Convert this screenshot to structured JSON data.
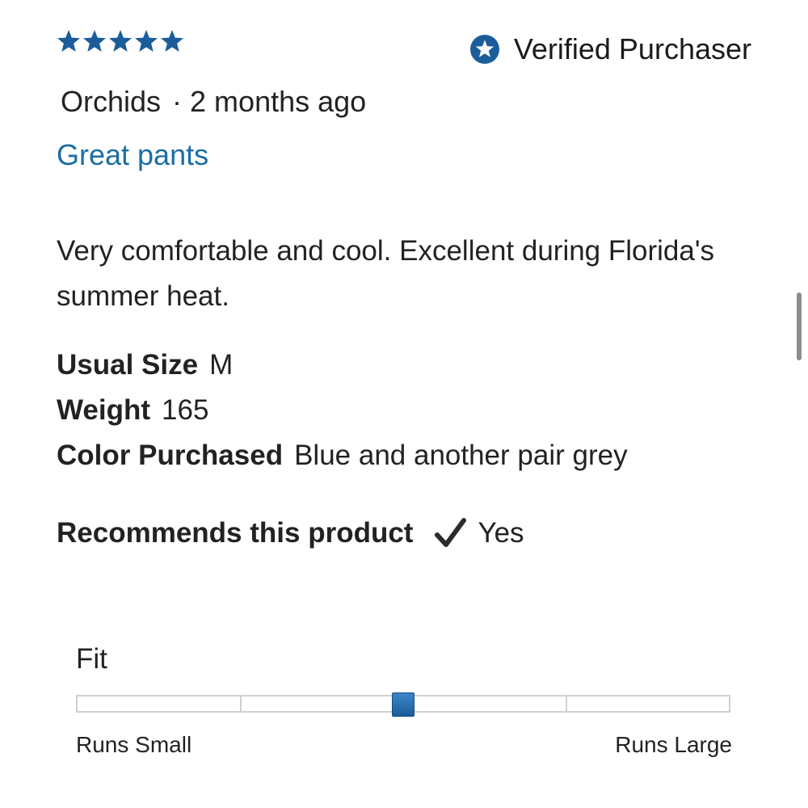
{
  "rating": {
    "stars": 5,
    "max": 5,
    "color": "#1b5d9a"
  },
  "verified": {
    "label": "Verified Purchaser",
    "icon": "star-badge-icon",
    "color": "#1b5d9a"
  },
  "author": {
    "name": "Orchids",
    "separator": "·",
    "time": "2 months ago"
  },
  "review": {
    "title": "Great pants",
    "title_color": "#1b6da2",
    "body": "Very comfortable and cool. Excellent during Florida's summer heat."
  },
  "attributes": [
    {
      "label": "Usual Size",
      "value": "M"
    },
    {
      "label": "Weight",
      "value": "165"
    },
    {
      "label": "Color Purchased",
      "value": "Blue and another pair grey"
    }
  ],
  "recommends": {
    "label": "Recommends this product",
    "icon": "checkmark-icon",
    "value": "Yes"
  },
  "fit": {
    "label": "Fit",
    "min_label": "Runs Small",
    "max_label": "Runs Large",
    "segments": 4,
    "value": 0.5
  }
}
